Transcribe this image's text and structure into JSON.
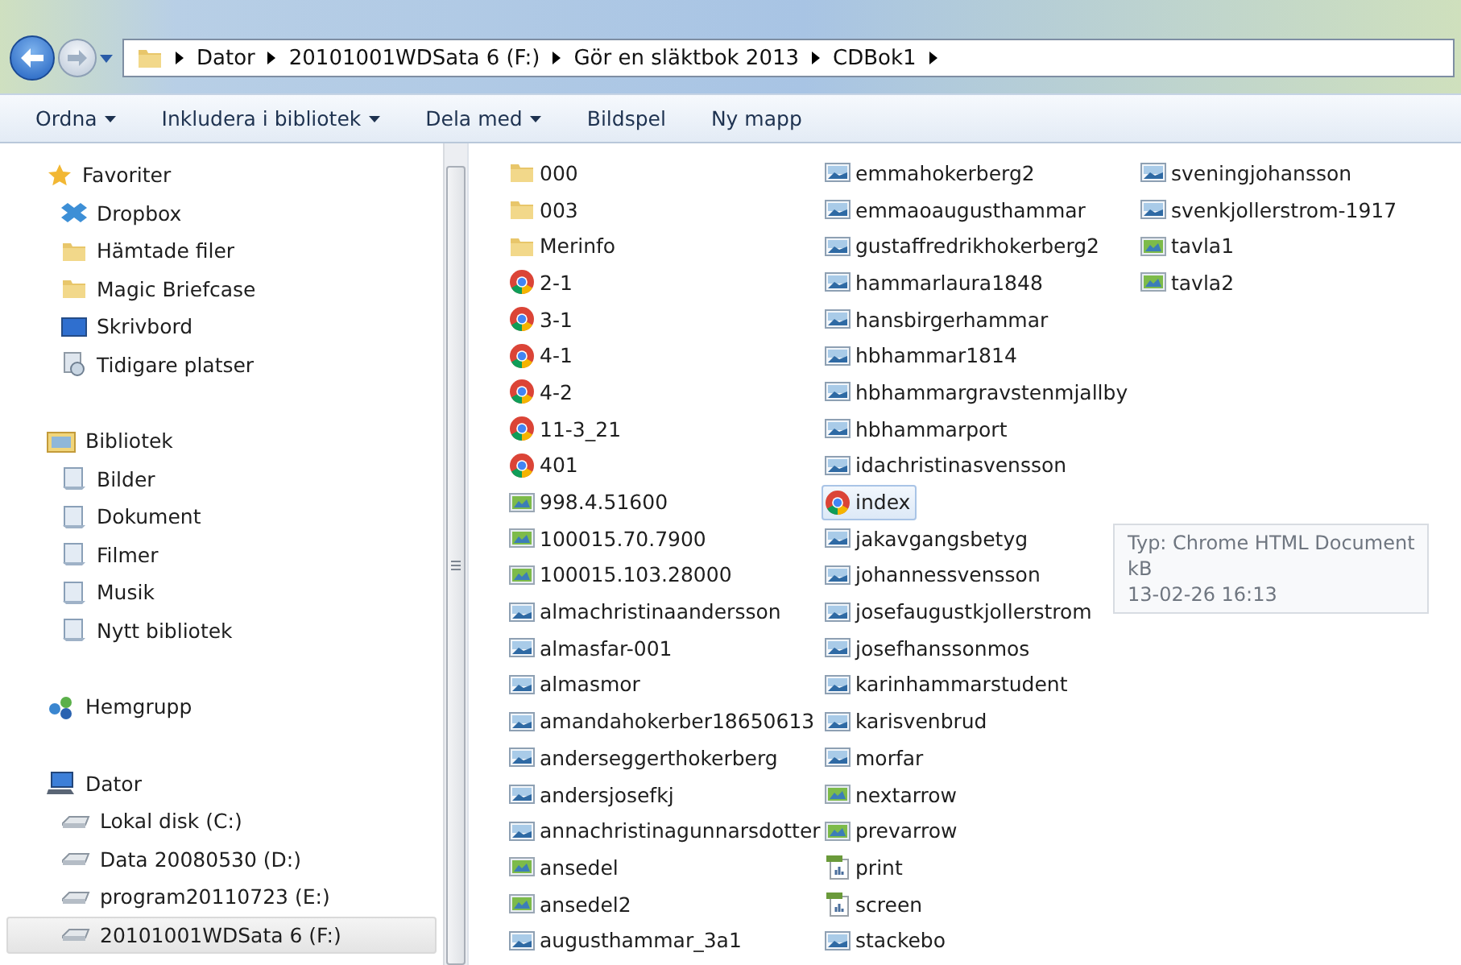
{
  "address_bar": {
    "crumbs": [
      "Dator",
      "20101001WDSata 6 (F:)",
      "Gör en släktbok 2013",
      "CDBok1"
    ]
  },
  "toolbar": [
    {
      "label": "Ordna",
      "dropdown": true
    },
    {
      "label": "Inkludera i bibliotek",
      "dropdown": true
    },
    {
      "label": "Dela med",
      "dropdown": true
    },
    {
      "label": "Bildspel",
      "dropdown": false
    },
    {
      "label": "Ny mapp",
      "dropdown": false
    }
  ],
  "sidebar": [
    {
      "label": "Favoriter",
      "kind": "star",
      "children": [
        {
          "label": "Dropbox",
          "kind": "dropbox",
          "selected": false
        },
        {
          "label": "Hämtade filer",
          "kind": "folder",
          "selected": false
        },
        {
          "label": "Magic Briefcase",
          "kind": "folder",
          "selected": false
        },
        {
          "label": "Skrivbord",
          "kind": "desktop",
          "selected": false
        },
        {
          "label": "Tidigare platser",
          "kind": "recent",
          "selected": false
        }
      ]
    },
    {
      "label": "Bibliotek",
      "kind": "library",
      "children": [
        {
          "label": "Bilder",
          "kind": "lib",
          "selected": false
        },
        {
          "label": "Dokument",
          "kind": "lib",
          "selected": false
        },
        {
          "label": "Filmer",
          "kind": "lib",
          "selected": false
        },
        {
          "label": "Musik",
          "kind": "lib",
          "selected": false
        },
        {
          "label": "Nytt bibliotek",
          "kind": "lib",
          "selected": false
        }
      ]
    },
    {
      "label": "Hemgrupp",
      "kind": "homegroup"
    },
    {
      "label": "Dator",
      "kind": "computer",
      "children": [
        {
          "label": "Lokal disk (C:)",
          "kind": "drive",
          "selected": false
        },
        {
          "label": "Data 20080530 (D:)",
          "kind": "drive",
          "selected": false
        },
        {
          "label": "program20110723 (E:)",
          "kind": "drive",
          "selected": false
        },
        {
          "label": "20101001WDSata 6 (F:)",
          "kind": "drive",
          "selected": true
        }
      ]
    }
  ],
  "files": [
    {
      "name": "000",
      "kind": "folder",
      "selected": false
    },
    {
      "name": "003",
      "kind": "folder",
      "selected": false
    },
    {
      "name": "Merinfo",
      "kind": "folder",
      "selected": false
    },
    {
      "name": "2-1",
      "kind": "chrome",
      "selected": false
    },
    {
      "name": "3-1",
      "kind": "chrome",
      "selected": false
    },
    {
      "name": "4-1",
      "kind": "chrome",
      "selected": false
    },
    {
      "name": "4-2",
      "kind": "chrome",
      "selected": false
    },
    {
      "name": "11-3_21",
      "kind": "chrome",
      "selected": false
    },
    {
      "name": "401",
      "kind": "chrome",
      "selected": false
    },
    {
      "name": "998.4.51600",
      "kind": "picture",
      "selected": false
    },
    {
      "name": "100015.70.7900",
      "kind": "picture",
      "selected": false
    },
    {
      "name": "100015.103.28000",
      "kind": "picture",
      "selected": false
    },
    {
      "name": "almachristinaandersson",
      "kind": "image",
      "selected": false
    },
    {
      "name": "almasfar-001",
      "kind": "image",
      "selected": false
    },
    {
      "name": "almasmor",
      "kind": "image",
      "selected": false
    },
    {
      "name": "amandahokerber18650613",
      "kind": "image",
      "selected": false
    },
    {
      "name": "anderseggerthokerberg",
      "kind": "image",
      "selected": false
    },
    {
      "name": "andersjosefkj",
      "kind": "image",
      "selected": false
    },
    {
      "name": "annachristinagunnarsdotter",
      "kind": "image",
      "selected": false
    },
    {
      "name": "ansedel",
      "kind": "picture",
      "selected": false
    },
    {
      "name": "ansedel2",
      "kind": "picture",
      "selected": false
    },
    {
      "name": "augusthammar_3a1",
      "kind": "image",
      "selected": false
    },
    {
      "name": "emmahokerberg2",
      "kind": "image",
      "selected": false
    },
    {
      "name": "emmaoaugusthammar",
      "kind": "image",
      "selected": false
    },
    {
      "name": "gustaffredrikhokerberg2",
      "kind": "image",
      "selected": false
    },
    {
      "name": "hammarlaura1848",
      "kind": "image",
      "selected": false
    },
    {
      "name": "hansbirgerhammar",
      "kind": "image",
      "selected": false
    },
    {
      "name": "hbhammar1814",
      "kind": "image",
      "selected": false
    },
    {
      "name": "hbhammargravstenmjallby",
      "kind": "image",
      "selected": false
    },
    {
      "name": "hbhammarport",
      "kind": "image",
      "selected": false
    },
    {
      "name": "idachristinasvensson",
      "kind": "image",
      "selected": false
    },
    {
      "name": "index",
      "kind": "chrome",
      "selected": true
    },
    {
      "name": "jakavgangsbetyg",
      "kind": "image",
      "selected": false
    },
    {
      "name": "johannessvensson",
      "kind": "image",
      "selected": false
    },
    {
      "name": "josefaugustkjollerstrom",
      "kind": "image",
      "selected": false
    },
    {
      "name": "josefhanssonmos",
      "kind": "image",
      "selected": false
    },
    {
      "name": "karinhammarstudent",
      "kind": "image",
      "selected": false
    },
    {
      "name": "karisvenbrud",
      "kind": "image",
      "selected": false
    },
    {
      "name": "morfar",
      "kind": "image",
      "selected": false
    },
    {
      "name": "nextarrow",
      "kind": "picture",
      "selected": false
    },
    {
      "name": "prevarrow",
      "kind": "picture",
      "selected": false
    },
    {
      "name": "print",
      "kind": "document",
      "selected": false
    },
    {
      "name": "screen",
      "kind": "document",
      "selected": false
    },
    {
      "name": "stackebo",
      "kind": "image",
      "selected": false
    },
    {
      "name": "sveningjohansson",
      "kind": "image",
      "selected": false
    },
    {
      "name": "svenkjollerstrom-1917",
      "kind": "image",
      "selected": false
    },
    {
      "name": "tavla1",
      "kind": "picture",
      "selected": false
    },
    {
      "name": "tavla2",
      "kind": "picture",
      "selected": false
    }
  ],
  "tooltip": {
    "lines": [
      "Typ: Chrome HTML Document",
      "kB",
      "13-02-26 16:13"
    ]
  }
}
